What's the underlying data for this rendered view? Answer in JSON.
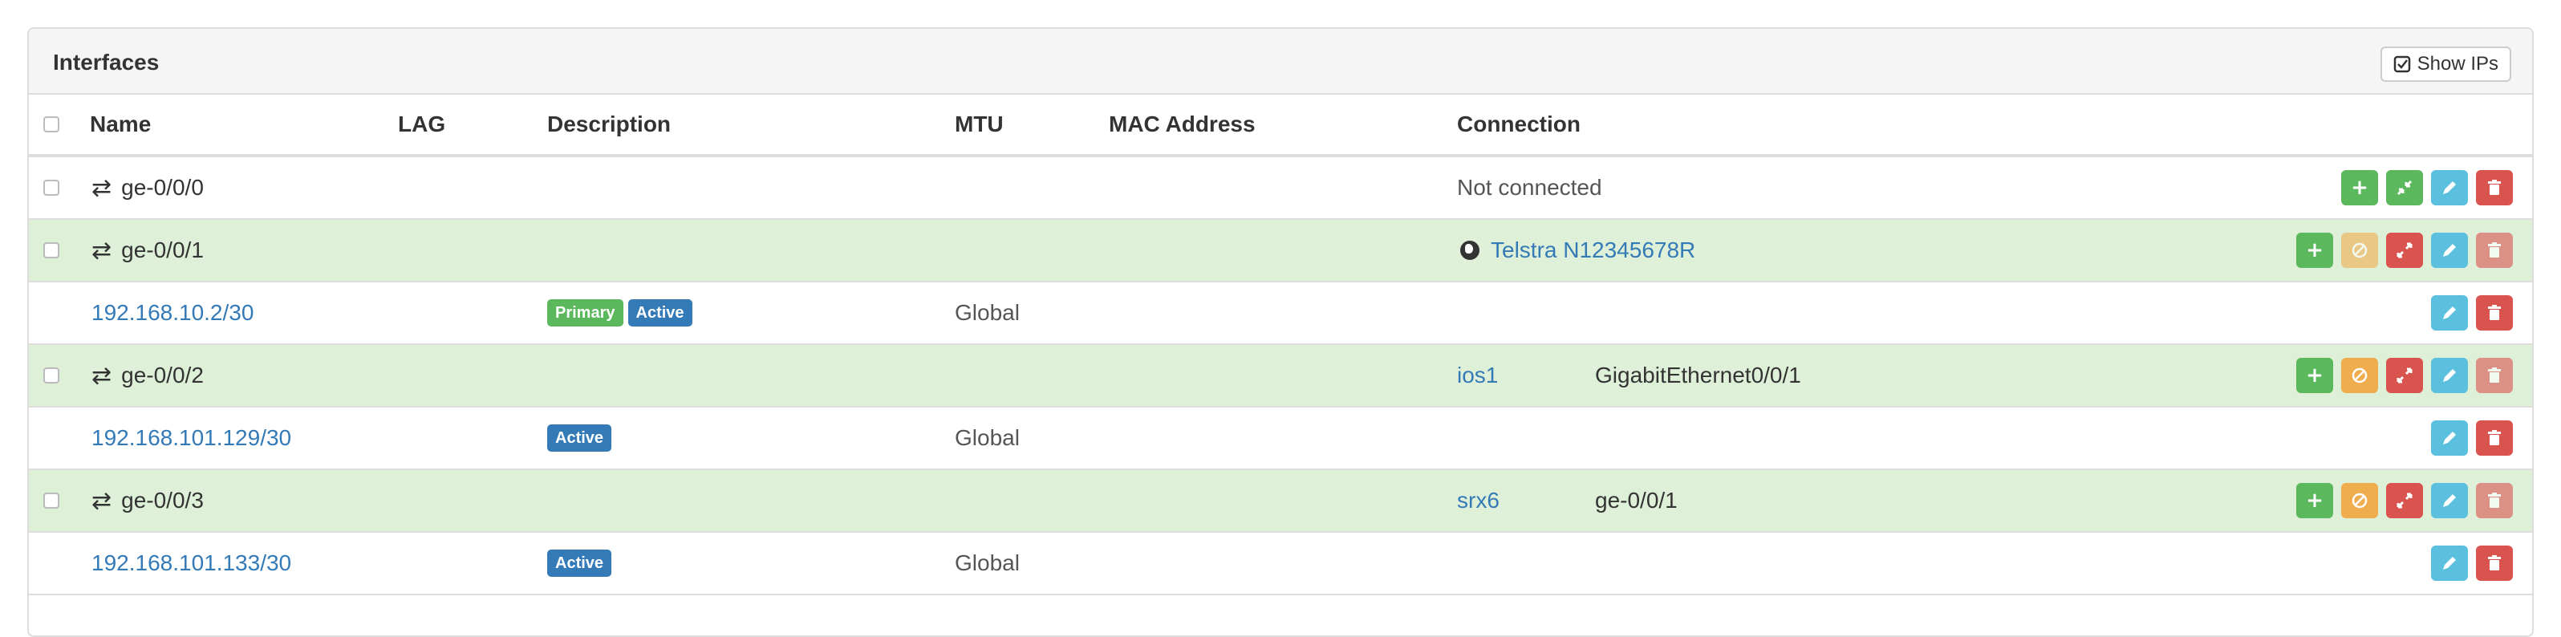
{
  "panel": {
    "title": "Interfaces",
    "show_ips_label": "Show IPs"
  },
  "columns": {
    "name": "Name",
    "lag": "LAG",
    "description": "Description",
    "mtu": "MTU",
    "mac": "MAC Address",
    "connection": "Connection"
  },
  "rows": [
    {
      "type": "interface",
      "name": "ge-0/0/0",
      "connection": "Not connected"
    },
    {
      "type": "interface",
      "name": "ge-0/0/1",
      "connection_link": "Telstra N12345678R"
    },
    {
      "type": "ip",
      "address": "192.168.10.2/30",
      "badges": [
        "Primary",
        "Active"
      ],
      "vrf": "Global"
    },
    {
      "type": "interface",
      "name": "ge-0/0/2",
      "peer_device": "ios1",
      "peer_interface": "GigabitEthernet0/0/1"
    },
    {
      "type": "ip",
      "address": "192.168.101.129/30",
      "badges": [
        "Active"
      ],
      "vrf": "Global"
    },
    {
      "type": "interface",
      "name": "ge-0/0/3",
      "peer_device": "srx6",
      "peer_interface": "ge-0/0/1"
    },
    {
      "type": "ip",
      "address": "192.168.101.133/30",
      "badges": [
        "Active"
      ],
      "vrf": "Global"
    }
  ],
  "colors": {
    "connected_row": "#dff0d8",
    "link": "#337ab7",
    "success": "#5cb85c",
    "warning": "#f0ad4e",
    "danger": "#d9534f",
    "info": "#5bc0de"
  }
}
